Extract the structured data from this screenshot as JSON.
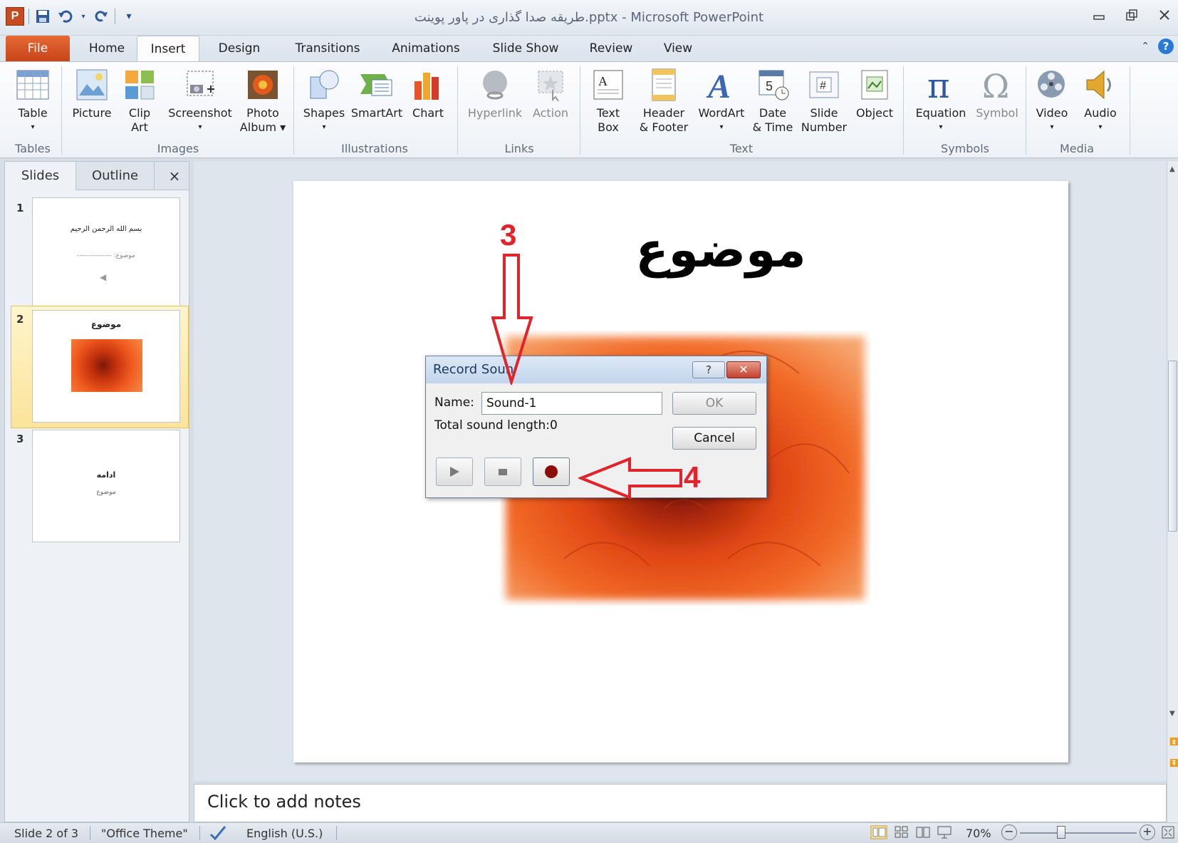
{
  "window": {
    "title": "طريقه صدا گذاری در پاور پوینت.pptx - Microsoft PowerPoint",
    "app_logo": "P",
    "controls": [
      "minimize-icon",
      "restore-icon",
      "close-icon"
    ]
  },
  "tabs": [
    "File",
    "Home",
    "Insert",
    "Design",
    "Transitions",
    "Animations",
    "Slide Show",
    "Review",
    "View"
  ],
  "active_tab": "Insert",
  "ribbon": {
    "buttons": {
      "table": [
        "Table",
        ""
      ],
      "picture": [
        "Picture",
        ""
      ],
      "clipart": [
        "Clip",
        "Art"
      ],
      "screenshot": [
        "Screenshot",
        ""
      ],
      "photoalbum": [
        "Photo",
        "Album ▾"
      ],
      "shapes": [
        "Shapes",
        ""
      ],
      "smartart": [
        "SmartArt",
        ""
      ],
      "chart": [
        "Chart",
        ""
      ],
      "hyperlink": [
        "Hyperlink",
        ""
      ],
      "action": [
        "Action",
        ""
      ],
      "textbox": [
        "Text",
        "Box"
      ],
      "header": [
        "Header",
        "& Footer"
      ],
      "wordart": [
        "WordArt",
        ""
      ],
      "datetime": [
        "Date",
        "& Time"
      ],
      "slidenumber": [
        "Slide",
        "Number"
      ],
      "object": [
        "Object",
        ""
      ],
      "equation": [
        "Equation",
        ""
      ],
      "symbol": [
        "Symbol",
        ""
      ],
      "video": [
        "Video",
        ""
      ],
      "audio": [
        "Audio",
        ""
      ]
    },
    "groups": {
      "tables": "Tables",
      "images": "Images",
      "illustrations": "Illustrations",
      "links": "Links",
      "text": "Text",
      "symbols": "Symbols",
      "media": "Media"
    }
  },
  "left_pane": {
    "tabs": {
      "slides": "Slides",
      "outline": "Outline",
      "close": "×"
    },
    "thumbnails": [
      {
        "number": "1",
        "line1": "بسم الله الرحمن الرحيم",
        "line2": "موضوع: ---------------"
      },
      {
        "number": "2",
        "title": "موضوع"
      },
      {
        "number": "3",
        "line1": "ادامه",
        "line2": "موضوع"
      }
    ],
    "selected": "2"
  },
  "slide": {
    "title": "موضوع"
  },
  "dialog": {
    "title": "Record Soun",
    "help": "?",
    "close": "✕",
    "name_label": "Name:",
    "name_value": "Sound-1",
    "length_label": "Total sound length:",
    "length_value": "0",
    "ok": "OK",
    "cancel": "Cancel",
    "controls": [
      "play-icon",
      "stop-icon",
      "record-icon"
    ]
  },
  "annotations": {
    "step3": "3",
    "step4": "4",
    "color": "#e0242a"
  },
  "notes": {
    "placeholder": "Click to add notes"
  },
  "status": {
    "slide": "Slide 2 of 3",
    "theme": "\"Office Theme\"",
    "language": "English (U.S.)",
    "zoom": "70%",
    "zoom_minus": "−",
    "zoom_plus": "+"
  },
  "colors": {
    "file_tab": "#d2501f",
    "selection": "#fbe49a",
    "flower": "#e2481a"
  }
}
